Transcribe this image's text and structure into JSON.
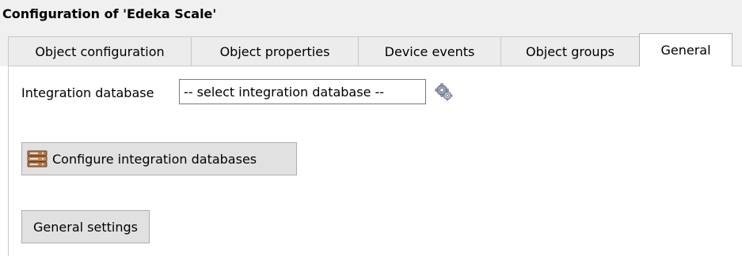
{
  "window": {
    "title": "Configuration of 'Edeka Scale'"
  },
  "tabs": [
    {
      "label": "Object configuration",
      "active": false
    },
    {
      "label": "Object properties",
      "active": false
    },
    {
      "label": "Device events",
      "active": false
    },
    {
      "label": "Object groups",
      "active": false
    },
    {
      "label": "General",
      "active": true
    }
  ],
  "general": {
    "integration_database_label": "Integration database",
    "integration_database_select": {
      "value": "-- select integration database --"
    },
    "settings_icon": "gear-icon",
    "configure_button_icon": "database-icon",
    "configure_button_label": "Configure integration databases",
    "general_settings_button_label": "General settings"
  },
  "colors": {
    "tab_active_bg": "#ffffff",
    "tab_inactive_bg": "#ececec",
    "button_bg": "#e1e1e1",
    "chrome_bg": "#f0f0f0"
  }
}
